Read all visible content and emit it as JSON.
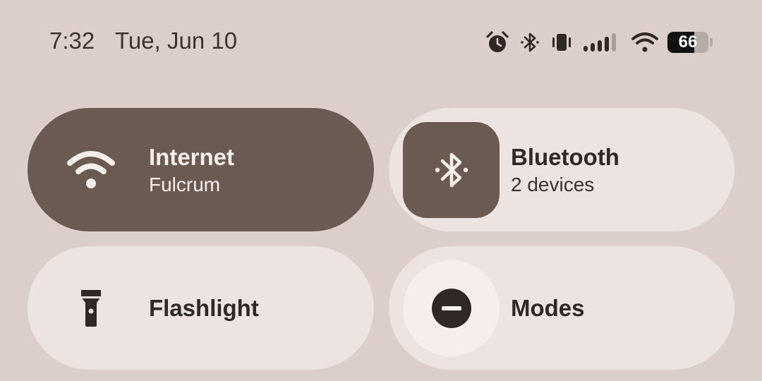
{
  "status_bar": {
    "time": "7:32",
    "date": "Tue, Jun 10",
    "icons": [
      "alarm-icon",
      "bluetooth-icon",
      "vibrate-icon",
      "cell-signal-icon",
      "wifi-icon",
      "battery-icon"
    ],
    "battery_level": "66",
    "battery_fraction": 0.66
  },
  "tiles": {
    "internet": {
      "title": "Internet",
      "subtitle": "Fulcrum",
      "icon": "wifi-icon",
      "active": true
    },
    "bluetooth": {
      "title": "Bluetooth",
      "subtitle": "2 devices",
      "icon": "bluetooth-icon",
      "active": true
    },
    "flashlight": {
      "title": "Flashlight",
      "icon": "flashlight-icon",
      "active": false
    },
    "modes": {
      "title": "Modes",
      "icon": "do-not-disturb-icon",
      "active": false
    }
  },
  "colors": {
    "background": "#dccfcb",
    "active_tile": "#6b5a51",
    "inactive_tile": "#ede3e0",
    "text_dark": "#2f2825",
    "text_light": "#f7efeb"
  }
}
